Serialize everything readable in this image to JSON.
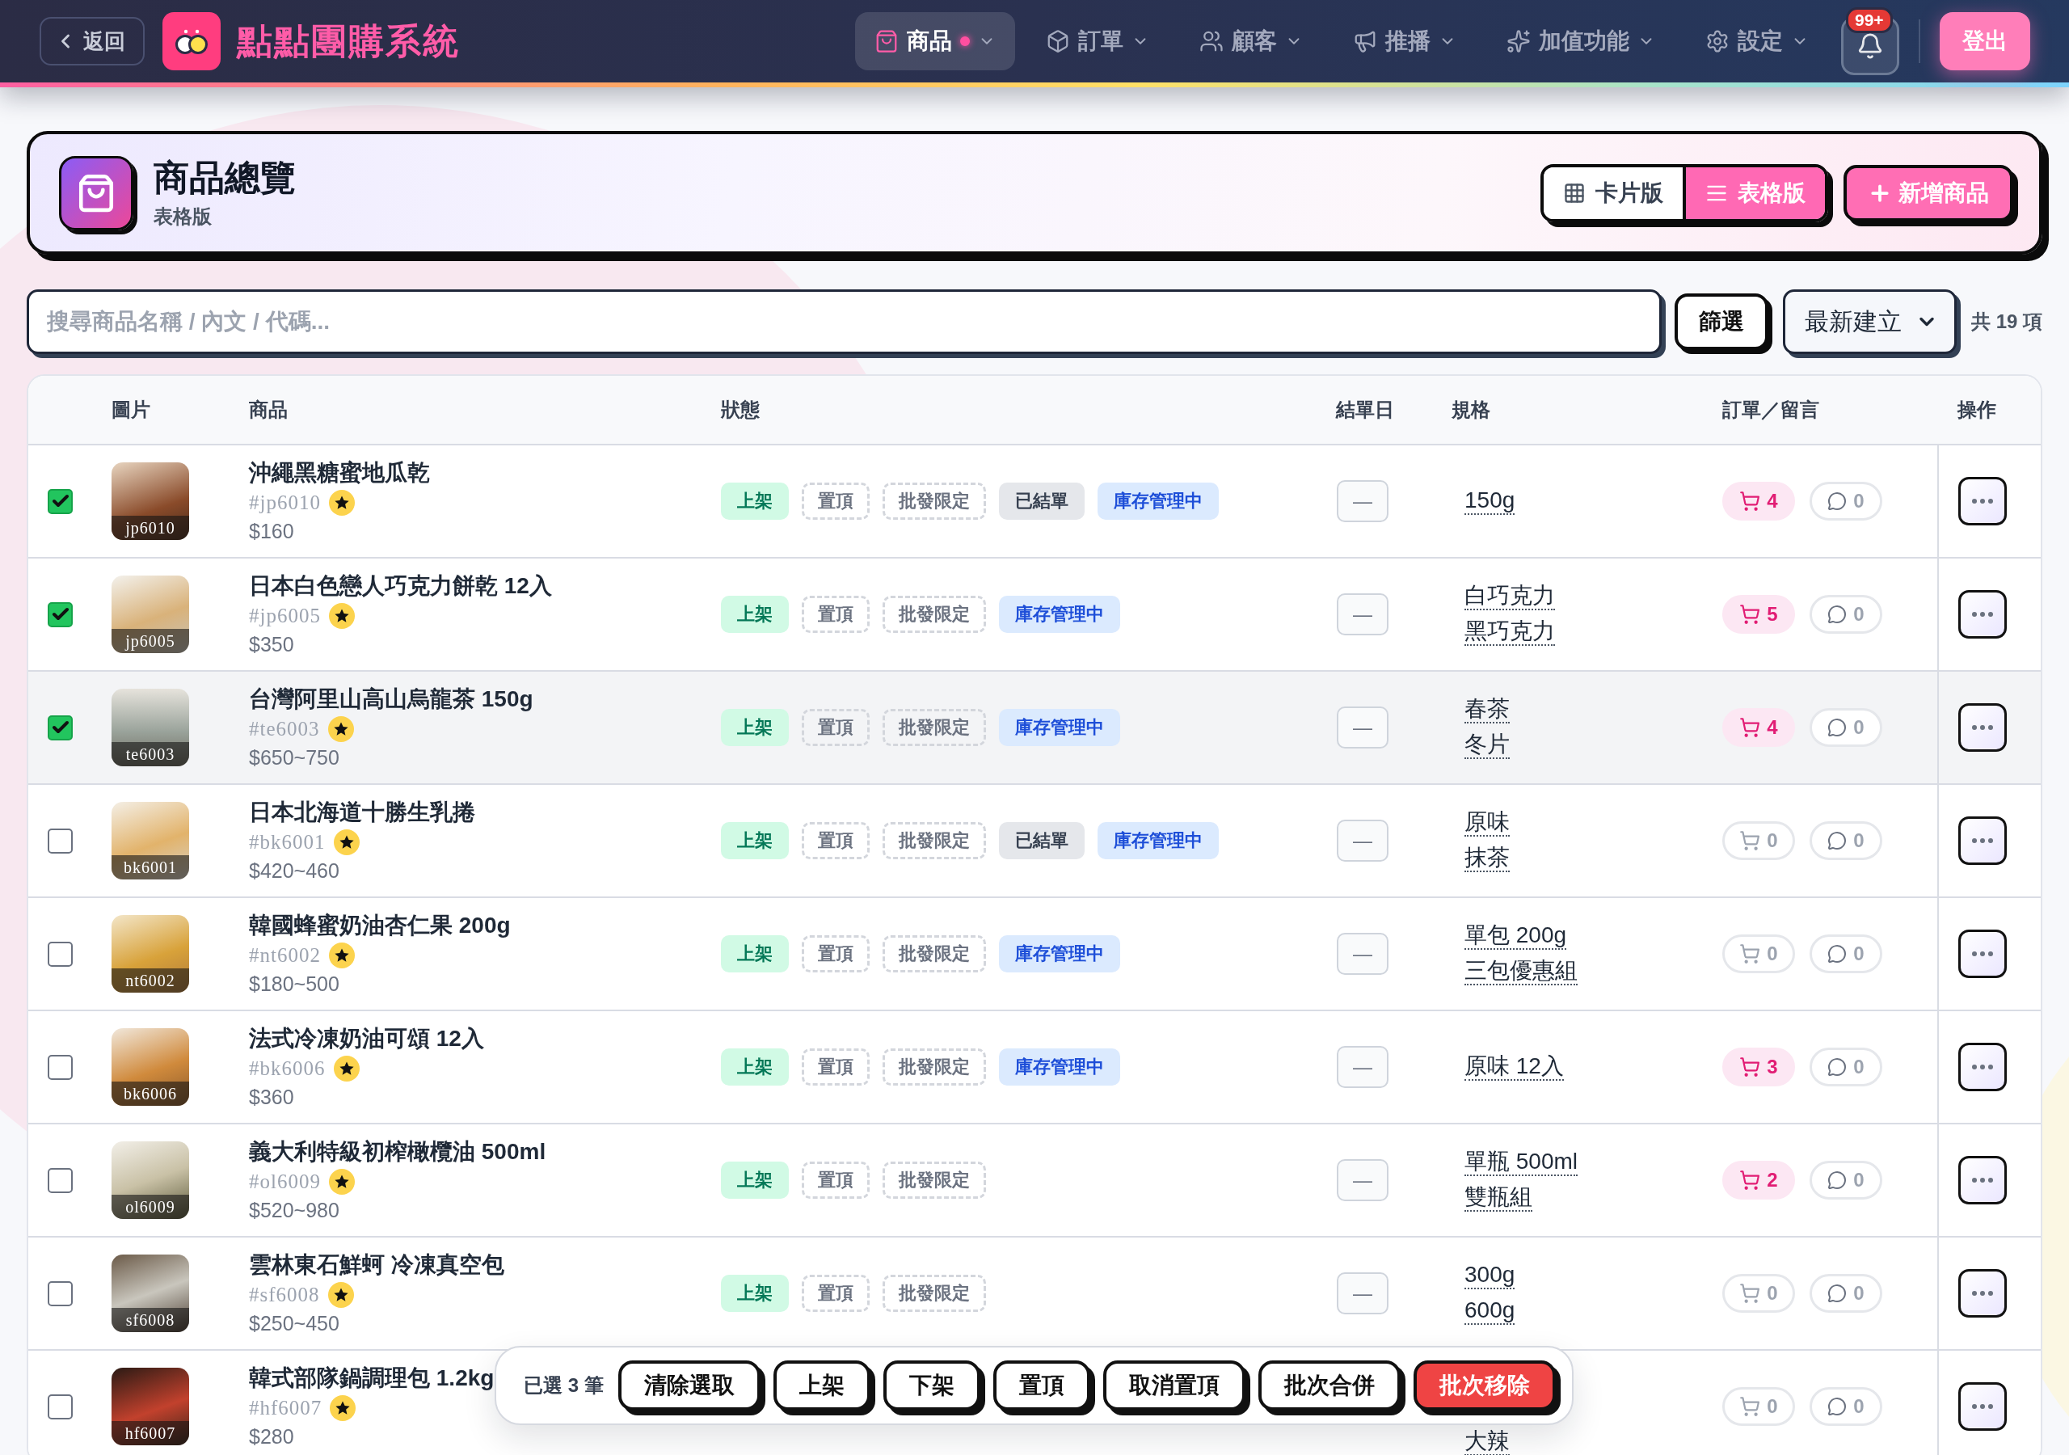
{
  "nav": {
    "back": "返回",
    "title": "點點團購系統",
    "items": [
      {
        "label": "商品",
        "selected": true,
        "dot": true
      },
      {
        "label": "訂單",
        "selected": false,
        "dot": false
      },
      {
        "label": "顧客",
        "selected": false,
        "dot": false
      },
      {
        "label": "推播",
        "selected": false,
        "dot": false
      },
      {
        "label": "加值功能",
        "selected": false,
        "dot": false
      },
      {
        "label": "設定",
        "selected": false,
        "dot": false
      }
    ],
    "notifications": "99+",
    "logout": "登出"
  },
  "header": {
    "title": "商品總覽",
    "subtitle": "表格版",
    "views": [
      {
        "label": "卡片版",
        "selected": false
      },
      {
        "label": "表格版",
        "selected": true
      }
    ],
    "add_button": "新增商品"
  },
  "filters": {
    "search": {
      "placeholder": "搜尋商品名稱 / 內文 / 代碼..."
    },
    "filter_button": "篩選",
    "sort": "最新建立",
    "count": "共 19 項"
  },
  "table": {
    "columns": [
      "圖片",
      "商品",
      "狀態",
      "結單日",
      "規格",
      "訂單／留言",
      "操作"
    ],
    "rows": [
      {
        "selected": true,
        "hovered": false,
        "thumb_label": "jp6010",
        "name": "沖繩黑糖蜜地瓜乾",
        "sku": "#jp6010",
        "featured": true,
        "price": "$160",
        "tags": [
          {
            "label": "上架",
            "kind": "live"
          },
          {
            "label": "置頂",
            "kind": "dashed"
          },
          {
            "label": "批發限定",
            "kind": "dashed"
          },
          {
            "label": "已結單",
            "kind": "closed"
          },
          {
            "label": "庫存管理中",
            "kind": "stock"
          }
        ],
        "close_date": "—",
        "specs": [
          "150g"
        ],
        "orders": "4",
        "orders_active": true,
        "comments": "0",
        "under_bulk_bar": false
      },
      {
        "selected": true,
        "hovered": false,
        "thumb_label": "jp6005",
        "name": "日本白色戀人巧克力餅乾 12入",
        "sku": "#jp6005",
        "featured": true,
        "price": "$350",
        "tags": [
          {
            "label": "上架",
            "kind": "live"
          },
          {
            "label": "置頂",
            "kind": "dashed"
          },
          {
            "label": "批發限定",
            "kind": "dashed"
          },
          {
            "label": "庫存管理中",
            "kind": "stock"
          }
        ],
        "close_date": "—",
        "specs": [
          "白巧克力",
          "黑巧克力"
        ],
        "orders": "5",
        "orders_active": true,
        "comments": "0",
        "under_bulk_bar": false
      },
      {
        "selected": true,
        "hovered": true,
        "thumb_label": "te6003",
        "name": "台灣阿里山高山烏龍茶 150g",
        "sku": "#te6003",
        "featured": true,
        "price": "$650~750",
        "tags": [
          {
            "label": "上架",
            "kind": "live"
          },
          {
            "label": "置頂",
            "kind": "dashed"
          },
          {
            "label": "批發限定",
            "kind": "dashed"
          },
          {
            "label": "庫存管理中",
            "kind": "stock"
          }
        ],
        "close_date": "—",
        "specs": [
          "春茶",
          "冬片"
        ],
        "orders": "4",
        "orders_active": true,
        "comments": "0",
        "under_bulk_bar": false
      },
      {
        "selected": false,
        "hovered": false,
        "thumb_label": "bk6001",
        "name": "日本北海道十勝生乳捲",
        "sku": "#bk6001",
        "featured": true,
        "price": "$420~460",
        "tags": [
          {
            "label": "上架",
            "kind": "live"
          },
          {
            "label": "置頂",
            "kind": "dashed"
          },
          {
            "label": "批發限定",
            "kind": "dashed"
          },
          {
            "label": "已結單",
            "kind": "closed"
          },
          {
            "label": "庫存管理中",
            "kind": "stock"
          }
        ],
        "close_date": "—",
        "specs": [
          "原味",
          "抹茶"
        ],
        "orders": "0",
        "orders_active": false,
        "comments": "0",
        "under_bulk_bar": false
      },
      {
        "selected": false,
        "hovered": false,
        "thumb_label": "nt6002",
        "name": "韓國蜂蜜奶油杏仁果 200g",
        "sku": "#nt6002",
        "featured": true,
        "price": "$180~500",
        "tags": [
          {
            "label": "上架",
            "kind": "live"
          },
          {
            "label": "置頂",
            "kind": "dashed"
          },
          {
            "label": "批發限定",
            "kind": "dashed"
          },
          {
            "label": "庫存管理中",
            "kind": "stock"
          }
        ],
        "close_date": "—",
        "specs": [
          "單包 200g",
          "三包優惠組"
        ],
        "orders": "0",
        "orders_active": false,
        "comments": "0",
        "under_bulk_bar": false
      },
      {
        "selected": false,
        "hovered": false,
        "thumb_label": "bk6006",
        "name": "法式冷凍奶油可頌 12入",
        "sku": "#bk6006",
        "featured": true,
        "price": "$360",
        "tags": [
          {
            "label": "上架",
            "kind": "live"
          },
          {
            "label": "置頂",
            "kind": "dashed"
          },
          {
            "label": "批發限定",
            "kind": "dashed"
          },
          {
            "label": "庫存管理中",
            "kind": "stock"
          }
        ],
        "close_date": "—",
        "specs": [
          "原味 12入"
        ],
        "orders": "3",
        "orders_active": true,
        "comments": "0",
        "under_bulk_bar": false
      },
      {
        "selected": false,
        "hovered": false,
        "thumb_label": "ol6009",
        "name": "義大利特級初榨橄欖油 500ml",
        "sku": "#ol6009",
        "featured": true,
        "price": "$520~980",
        "tags": [
          {
            "label": "上架",
            "kind": "live"
          },
          {
            "label": "置頂",
            "kind": "dashed"
          },
          {
            "label": "批發限定",
            "kind": "dashed"
          }
        ],
        "close_date": "—",
        "specs": [
          "單瓶 500ml",
          "雙瓶組"
        ],
        "orders": "2",
        "orders_active": true,
        "comments": "0",
        "under_bulk_bar": false
      },
      {
        "selected": false,
        "hovered": false,
        "thumb_label": "sf6008",
        "name": "雲林東石鮮蚵 冷凍真空包",
        "sku": "#sf6008",
        "featured": true,
        "price": "$250~450",
        "tags": [
          {
            "label": "上架",
            "kind": "live"
          },
          {
            "label": "置頂",
            "kind": "dashed"
          },
          {
            "label": "批發限定",
            "kind": "dashed"
          }
        ],
        "close_date": "—",
        "specs": [
          "300g",
          "600g"
        ],
        "orders": "0",
        "orders_active": false,
        "comments": "0",
        "under_bulk_bar": false
      },
      {
        "selected": false,
        "hovered": false,
        "thumb_label": "hf6007",
        "name": "韓式部隊鍋調理包 1.2kg",
        "sku": "#hf6007",
        "featured": true,
        "price": "$280",
        "tags": [],
        "specs": [
          "大辣"
        ],
        "orders": "0",
        "orders_active": false,
        "comments": "0",
        "under_bulk_bar": true
      }
    ]
  },
  "bulk_bar": {
    "summary": "已選 3 筆",
    "buttons": [
      {
        "label": "清除選取",
        "kind": "plain"
      },
      {
        "label": "上架",
        "kind": "plain"
      },
      {
        "label": "下架",
        "kind": "plain"
      },
      {
        "label": "置頂",
        "kind": "plain"
      },
      {
        "label": "取消置頂",
        "kind": "plain"
      },
      {
        "label": "批次合併",
        "kind": "plain"
      },
      {
        "label": "批次移除",
        "kind": "danger"
      }
    ]
  }
}
